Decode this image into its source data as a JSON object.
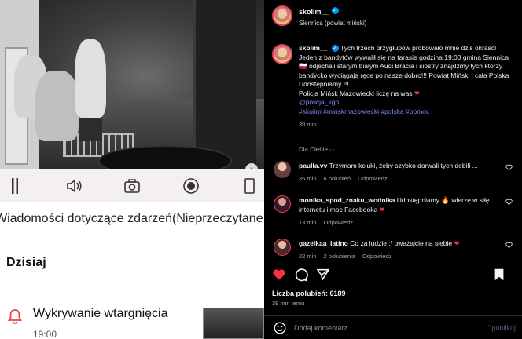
{
  "media": {
    "toolbar_icons": [
      "pause-icon",
      "volume-icon",
      "camera-icon",
      "record-icon",
      "rotate-icon"
    ],
    "news_title": "Wiadomości dotyczące zdarzeń(Nieprzeczytane",
    "section_today": "Dzisiaj",
    "event_name": "Wykrywanie wtargnięcia",
    "event_time": "19:00",
    "next_icon": "›"
  },
  "post": {
    "username": "skolim__",
    "location": "Siennica (powiat miński)",
    "caption_line1": "Tych trzech przygłupów próbowało mnie dziś okraść! Jeden z bandytów wywalił się na tarasie godzina 19:00 gmina Siennica ",
    "caption_line2": " odjechali starym białym Audi Bracia i siostry znajdźmy tych którzy bandycko wyciągają ręce po nasze dobro!!! Powiat Miński i cała Polska Udostępniamy !!!",
    "caption_line3": "Policja Mińsk Mazowiecki liczę na was ",
    "mention": "@policja_kgp",
    "hashtags": "#skolim #mińskmazowiecki #polska #pomoc",
    "time": "39 min"
  },
  "for_you": "Dla Ciebie",
  "comments": [
    {
      "user": "paulla.vv",
      "text": "Trzymam kciuki, żeby szybko dorwali tych debili ...",
      "time": "35 min",
      "likes": "6 polubień",
      "reply": "Odpowiedz"
    },
    {
      "user": "monika_spod_znaku_wodnika",
      "text": "Udostępniamy ",
      "text2": " wierzę w siłę internetu i moc Facebooka ",
      "time": "13 min",
      "reply": "Odpowiedz"
    },
    {
      "user": "gazelkaa_latino",
      "text": "Co za ludzie :/ uważajcie na siebie ",
      "time": "22 min",
      "likes": "2 polubienia",
      "reply": "Odpowiedz"
    }
  ],
  "likes_label": "Liczba polubień: 6189",
  "posted_ago": "39 min temu",
  "add_comment": {
    "placeholder": "Dodaj komentarz...",
    "publish": "Opublikuj"
  },
  "colors": {
    "like_red": "#ff3040",
    "link_blue": "#7a8cff",
    "verified_blue": "#0095f6",
    "alarm_red": "#e8453c"
  }
}
